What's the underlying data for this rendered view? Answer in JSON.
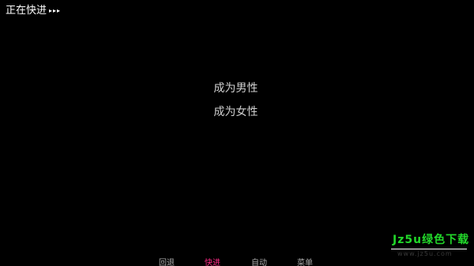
{
  "status": {
    "skip_text": "正在快进",
    "skip_arrows": "▸▸▸"
  },
  "choices": [
    {
      "label": "成为男性"
    },
    {
      "label": "成为女性"
    }
  ],
  "quick_menu": {
    "items": [
      {
        "label": "回退",
        "active": false
      },
      {
        "label": "快进",
        "active": true
      },
      {
        "label": "自动",
        "active": false
      },
      {
        "label": "菜单",
        "active": false
      }
    ],
    "colors": {
      "normal": "#aaaaaa",
      "active": "#ff2a86"
    }
  },
  "watermark": {
    "title": "Jz5u绿色下载",
    "url": "www.jz5u.com",
    "color": "#22d82a"
  },
  "colors": {
    "background": "#000000",
    "choice_text": "#cfcfcf",
    "status_text": "#ffffff"
  }
}
